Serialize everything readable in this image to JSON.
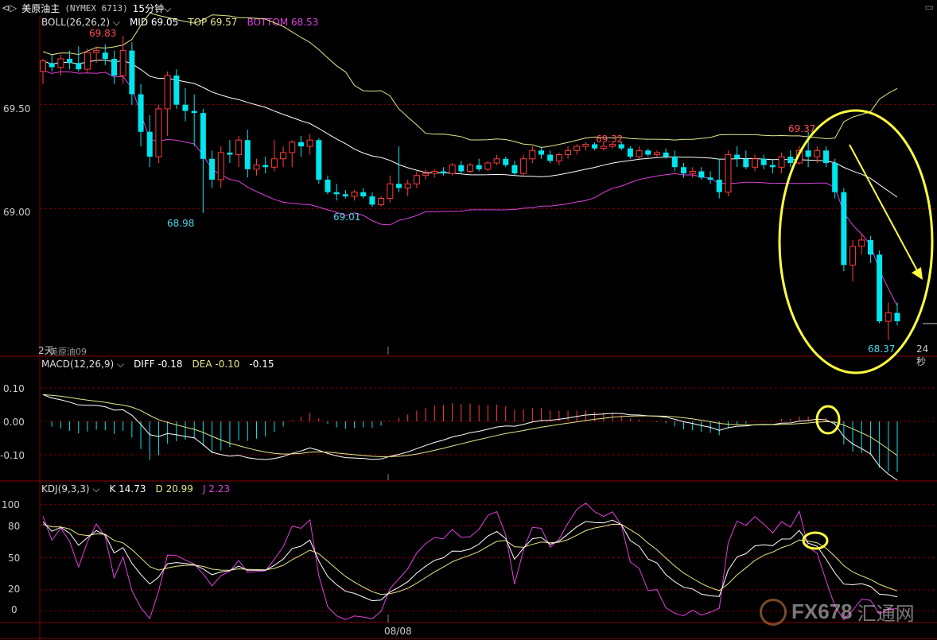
{
  "topbar": {
    "title": "美原油主",
    "symbol": "(NYMEX 6713)",
    "period": "15分钟"
  },
  "boll": {
    "label": "BOLL(26,26,2)",
    "mid": "MID 69.05",
    "top": "TOP 69.57",
    "bottom": "BOTTOM 68.53"
  },
  "macd": {
    "label": "MACD(12,26,9)",
    "diff": "DIFF -0.18",
    "dea": "DEA -0.10",
    "macd": "-0.15"
  },
  "kdj": {
    "label": "KDJ(9,3,3)",
    "k": "K 14.73",
    "d": "D 20.99",
    "j": "J 2.23"
  },
  "price_ticks": [
    "69.50",
    "69.00"
  ],
  "macd_ticks": [
    "0.10",
    "0.00",
    "-0.10"
  ],
  "kdj_ticks": [
    "100",
    "80",
    "50",
    "20",
    "0"
  ],
  "annotations": {
    "hi1": "69.83",
    "lo1": "68.98",
    "lo2": "69.01",
    "hi2": "69.32",
    "hi3": "69.37",
    "lo3": "68.37",
    "days": "2天",
    "contract": "美原油09",
    "seconds": "24秒",
    "date": "08/08",
    "watermark": "FX678",
    "watermark_cn": "汇通网"
  },
  "colors": {
    "up": "#ff3b3b",
    "down": "#00e5ee",
    "mid": "#ffffff",
    "top": "#e6e68a",
    "bottom": "#e040e0",
    "highlight": "#ffff40"
  },
  "chart_data": {
    "type": "candlestick",
    "ylim": [
      68.3,
      69.85
    ],
    "candles": [
      [
        69.66,
        69.72,
        69.6,
        69.71
      ],
      [
        69.7,
        69.74,
        69.66,
        69.68
      ],
      [
        69.68,
        69.74,
        69.64,
        69.72
      ],
      [
        69.72,
        69.76,
        69.67,
        69.7
      ],
      [
        69.7,
        69.78,
        69.66,
        69.67
      ],
      [
        69.67,
        69.77,
        69.65,
        69.75
      ],
      [
        69.75,
        69.78,
        69.7,
        69.76
      ],
      [
        69.75,
        69.79,
        69.69,
        69.72
      ],
      [
        69.72,
        69.76,
        69.6,
        69.64
      ],
      [
        69.64,
        69.83,
        69.6,
        69.76
      ],
      [
        69.76,
        69.8,
        69.5,
        69.55
      ],
      [
        69.55,
        69.6,
        69.3,
        69.37
      ],
      [
        69.37,
        69.45,
        69.2,
        69.25
      ],
      [
        69.25,
        69.5,
        69.22,
        69.48
      ],
      [
        69.48,
        69.66,
        69.35,
        69.64
      ],
      [
        69.64,
        69.67,
        69.48,
        69.5
      ],
      [
        69.5,
        69.58,
        69.42,
        69.47
      ],
      [
        69.47,
        69.55,
        69.3,
        69.46
      ],
      [
        69.46,
        69.48,
        68.98,
        69.24
      ],
      [
        69.24,
        69.28,
        69.1,
        69.14
      ],
      [
        69.14,
        69.3,
        69.1,
        69.27
      ],
      [
        69.27,
        69.33,
        69.22,
        69.26
      ],
      [
        69.26,
        69.35,
        69.2,
        69.33
      ],
      [
        69.33,
        69.38,
        69.15,
        69.19
      ],
      [
        69.19,
        69.24,
        69.16,
        69.21
      ],
      [
        69.21,
        69.25,
        69.17,
        69.2
      ],
      [
        69.2,
        69.33,
        69.18,
        69.24
      ],
      [
        69.24,
        69.3,
        69.2,
        69.27
      ],
      [
        69.27,
        69.33,
        69.2,
        69.32
      ],
      [
        69.32,
        69.35,
        69.25,
        69.3
      ],
      [
        69.3,
        69.36,
        69.26,
        69.33
      ],
      [
        69.33,
        69.34,
        69.12,
        69.14
      ],
      [
        69.14,
        69.16,
        69.07,
        69.08
      ],
      [
        69.08,
        69.12,
        69.04,
        69.07
      ],
      [
        69.07,
        69.09,
        69.05,
        69.06
      ],
      [
        69.06,
        69.09,
        69.04,
        69.08
      ],
      [
        69.08,
        69.1,
        69.05,
        69.06
      ],
      [
        69.06,
        69.08,
        69.01,
        69.02
      ],
      [
        69.02,
        69.06,
        69.01,
        69.05
      ],
      [
        69.05,
        69.16,
        69.03,
        69.12
      ],
      [
        69.12,
        69.3,
        69.08,
        69.1
      ],
      [
        69.1,
        69.14,
        69.06,
        69.12
      ],
      [
        69.12,
        69.18,
        69.1,
        69.16
      ],
      [
        69.16,
        69.19,
        69.14,
        69.17
      ],
      [
        69.17,
        69.19,
        69.15,
        69.18
      ],
      [
        69.18,
        69.2,
        69.16,
        69.17
      ],
      [
        69.17,
        69.22,
        69.16,
        69.21
      ],
      [
        69.21,
        69.23,
        69.17,
        69.18
      ],
      [
        69.18,
        69.22,
        69.17,
        69.21
      ],
      [
        69.21,
        69.24,
        69.18,
        69.19
      ],
      [
        69.19,
        69.23,
        69.18,
        69.22
      ],
      [
        69.22,
        69.26,
        69.21,
        69.24
      ],
      [
        69.24,
        69.25,
        69.2,
        69.21
      ],
      [
        69.21,
        69.23,
        69.16,
        69.17
      ],
      [
        69.17,
        69.26,
        69.16,
        69.24
      ],
      [
        69.24,
        69.3,
        69.22,
        69.28
      ],
      [
        69.28,
        69.3,
        69.24,
        69.26
      ],
      [
        69.26,
        69.28,
        69.22,
        69.23
      ],
      [
        69.23,
        69.27,
        69.21,
        69.26
      ],
      [
        69.26,
        69.3,
        69.24,
        69.28
      ],
      [
        69.28,
        69.31,
        69.26,
        69.3
      ],
      [
        69.3,
        69.32,
        69.28,
        69.31
      ],
      [
        69.31,
        69.32,
        69.28,
        69.29
      ],
      [
        69.29,
        69.32,
        69.28,
        69.3
      ],
      [
        69.3,
        69.32,
        69.29,
        69.31
      ],
      [
        69.31,
        69.32,
        69.28,
        69.29
      ],
      [
        69.29,
        69.3,
        69.24,
        69.25
      ],
      [
        69.25,
        69.3,
        69.24,
        69.28
      ],
      [
        69.28,
        69.29,
        69.25,
        69.26
      ],
      [
        69.26,
        69.28,
        69.25,
        69.27
      ],
      [
        69.27,
        69.29,
        69.24,
        69.25
      ],
      [
        69.25,
        69.28,
        69.18,
        69.2
      ],
      [
        69.2,
        69.22,
        69.15,
        69.17
      ],
      [
        69.17,
        69.2,
        69.15,
        69.18
      ],
      [
        69.18,
        69.2,
        69.14,
        69.15
      ],
      [
        69.15,
        69.18,
        69.12,
        69.14
      ],
      [
        69.14,
        69.24,
        69.05,
        69.08
      ],
      [
        69.08,
        69.28,
        69.06,
        69.26
      ],
      [
        69.26,
        69.3,
        69.2,
        69.24
      ],
      [
        69.24,
        69.28,
        69.19,
        69.2
      ],
      [
        69.2,
        69.26,
        69.18,
        69.24
      ],
      [
        69.24,
        69.26,
        69.19,
        69.21
      ],
      [
        69.21,
        69.24,
        69.17,
        69.2
      ],
      [
        69.2,
        69.27,
        69.17,
        69.25
      ],
      [
        69.25,
        69.28,
        69.2,
        69.22
      ],
      [
        69.22,
        69.3,
        69.21,
        69.28
      ],
      [
        69.28,
        69.37,
        69.2,
        69.25
      ],
      [
        69.25,
        69.3,
        69.22,
        69.28
      ],
      [
        69.28,
        69.3,
        69.2,
        69.22
      ],
      [
        69.22,
        69.24,
        69.05,
        69.08
      ],
      [
        69.08,
        69.1,
        68.7,
        68.73
      ],
      [
        68.73,
        68.85,
        68.65,
        68.82
      ],
      [
        68.82,
        68.88,
        68.78,
        68.85
      ],
      [
        68.85,
        68.87,
        68.74,
        68.78
      ],
      [
        68.78,
        68.8,
        68.45,
        68.46
      ],
      [
        68.46,
        68.55,
        68.37,
        68.5
      ],
      [
        68.5,
        68.55,
        68.44,
        68.46
      ]
    ]
  }
}
